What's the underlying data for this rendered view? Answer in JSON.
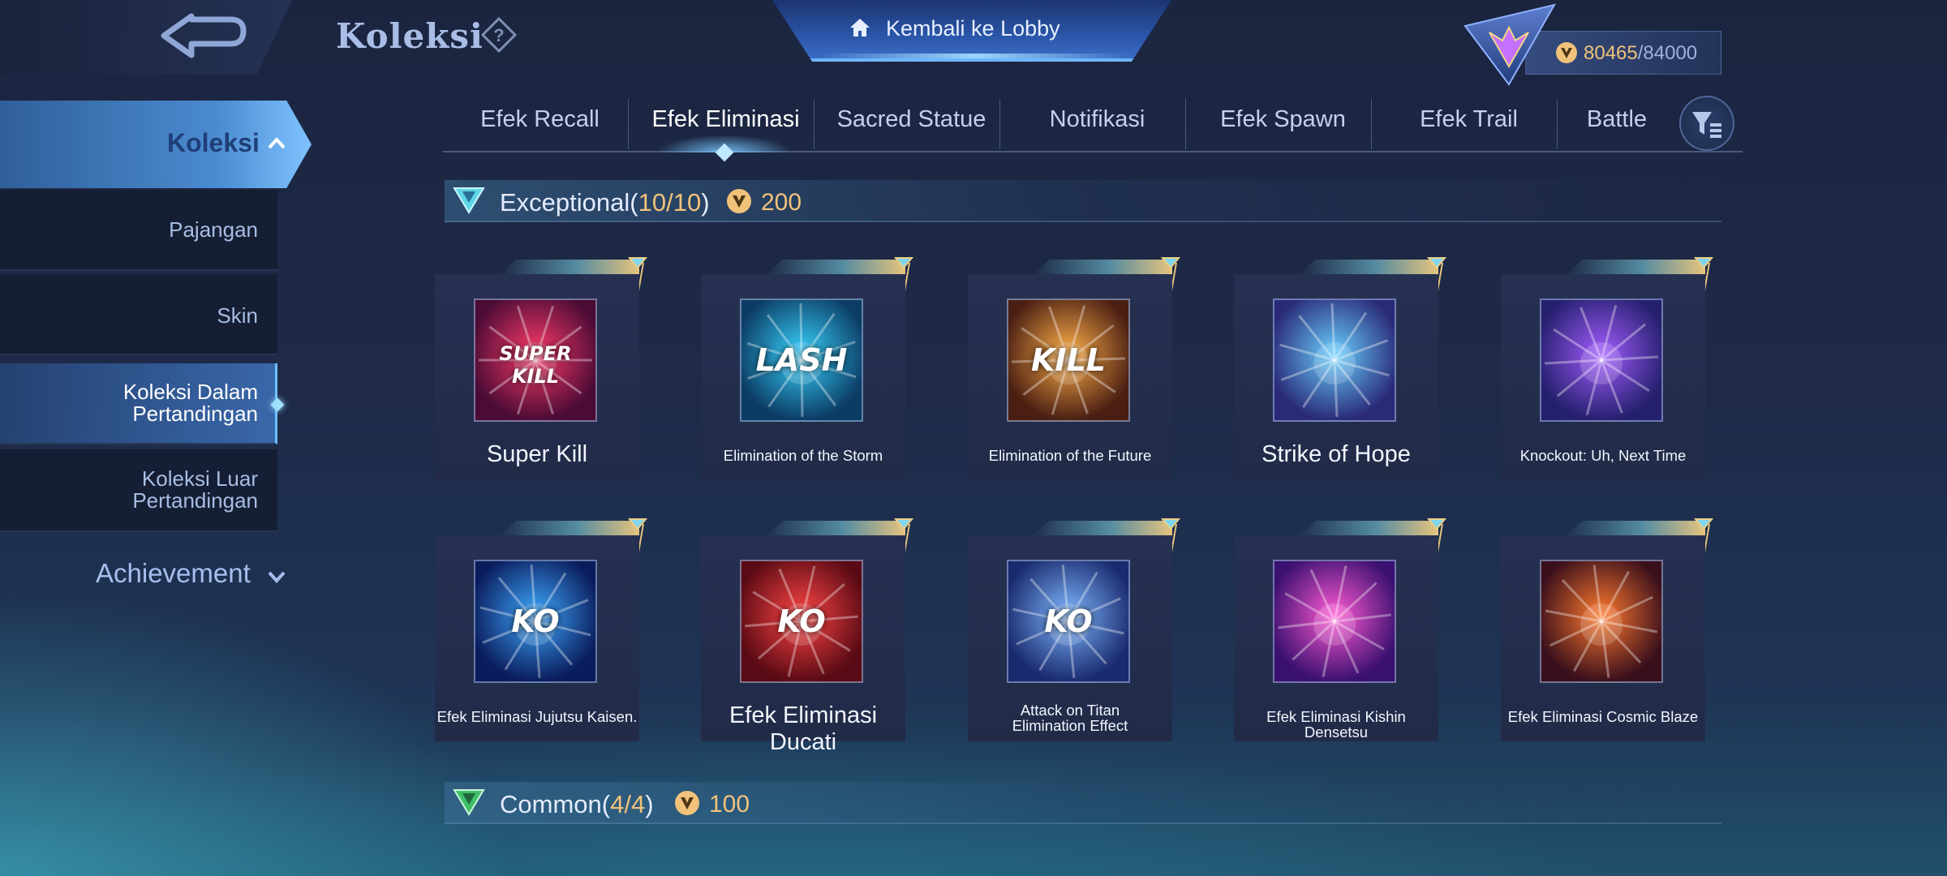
{
  "header": {
    "title": "Koleksi",
    "lobby_label": "Kembali ke Lobby",
    "currency_current": "80465",
    "currency_sep_total": "/84000"
  },
  "sidebar": {
    "active_section": "Koleksi",
    "items": [
      {
        "label_lines": [
          "Pajangan"
        ]
      },
      {
        "label_lines": [
          "Skin"
        ]
      },
      {
        "label_lines": [
          "Koleksi Dalam",
          "Pertandingan"
        ]
      },
      {
        "label_lines": [
          "Koleksi Luar",
          "Pertandingan"
        ]
      }
    ],
    "achievement_label": "Achievement"
  },
  "tabs": [
    "Efek Recall",
    "Efek Eliminasi",
    "Sacred Statue",
    "Notifikasi",
    "Efek Spawn",
    "Efek Trail",
    "Battle"
  ],
  "selected_tab_index": 1,
  "sections": {
    "exceptional": {
      "name": "Exceptional",
      "open_paren": "(",
      "count": "10/10",
      "close_paren": ")",
      "cost": "200",
      "cards": [
        {
          "title": "Super Kill",
          "thumb_text": "SUPER KILL",
          "palette": [
            "#ff3b6b",
            "#4a0b35"
          ]
        },
        {
          "title": "Elimination of the Storm",
          "thumb_text": "LASH",
          "palette": [
            "#39d3ff",
            "#0b3c64"
          ]
        },
        {
          "title": "Elimination of the Future",
          "thumb_text": "KILL",
          "palette": [
            "#ffb04a",
            "#4a1e12"
          ]
        },
        {
          "title": "Strike of Hope",
          "thumb_text": "",
          "palette": [
            "#6ad0ff",
            "#2a2a78"
          ]
        },
        {
          "title": "Knockout: Uh, Next Time",
          "thumb_text": "",
          "palette": [
            "#a35cff",
            "#25206e"
          ]
        },
        {
          "title": "Efek Eliminasi Jujutsu Kaisen.",
          "thumb_text": "KO",
          "palette": [
            "#3fa9ff",
            "#0a1c5c"
          ]
        },
        {
          "title": "Efek Eliminasi Ducati",
          "thumb_text": "KO",
          "palette": [
            "#ff4646",
            "#5a0a14"
          ]
        },
        {
          "title": "Attack on Titan Elimination Effect",
          "thumb_text": "KO",
          "palette": [
            "#7fb8ff",
            "#1a2a6e"
          ]
        },
        {
          "title": "Efek Eliminasi Kishin Densetsu",
          "thumb_text": "",
          "palette": [
            "#ff5ad2",
            "#3a1070"
          ]
        },
        {
          "title": "Efek Eliminasi Cosmic Blaze",
          "thumb_text": "",
          "palette": [
            "#ff7a2e",
            "#3a0f1c"
          ]
        }
      ]
    },
    "common": {
      "name": "Common",
      "open_paren": "(",
      "count": "4/4",
      "close_paren": ")",
      "cost": "100"
    }
  },
  "colors": {
    "accent_gold": "#f0c27a",
    "accent_blue": "#6cc0ff",
    "text_main": "#e4ecff"
  },
  "icons": [
    "back-arrow-icon",
    "help-icon",
    "home-icon",
    "rank-emblem-icon",
    "coin-icon",
    "chevron-up-icon",
    "chevron-down-icon",
    "filter-icon",
    "rarity-gem-icon"
  ]
}
